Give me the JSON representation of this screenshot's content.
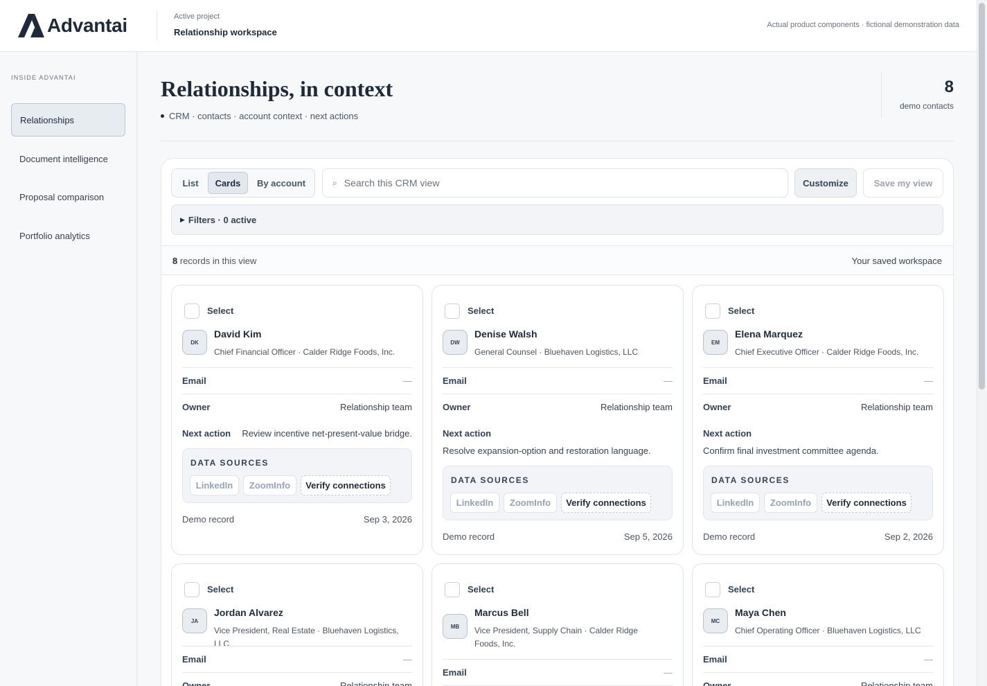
{
  "header": {
    "logo_text": "Advantai",
    "project_label": "Active project",
    "project_name": "Relationship workspace",
    "demo_note": "Actual product components · fictional demonstration data"
  },
  "sidebar": {
    "section_label": "INSIDE ADVANTAI",
    "items": [
      {
        "label": "Relationships",
        "active": true
      },
      {
        "label": "Document intelligence",
        "active": false
      },
      {
        "label": "Proposal comparison",
        "active": false
      },
      {
        "label": "Portfolio analytics",
        "active": false
      }
    ]
  },
  "main": {
    "title": "Relationships, in context",
    "subtitle": "CRM · contacts · account context · next actions",
    "stat_value": "8",
    "stat_label": "demo contacts"
  },
  "toolbar": {
    "views": [
      "List",
      "Cards",
      "By account"
    ],
    "active_view": "Cards",
    "search_placeholder": "Search this CRM view",
    "search_value": "",
    "customize_label": "Customize",
    "save_label": "Save my view",
    "filters_label": "Filters · 0 active",
    "records_count": "8",
    "records_suffix": "records in this view",
    "workspace_label": "Your saved workspace"
  },
  "card_labels": {
    "select": "Select",
    "email": "Email",
    "owner": "Owner",
    "next_action": "Next action",
    "data_sources": "DATA SOURCES",
    "linkedin": "LinkedIn",
    "zoominfo": "ZoomInfo",
    "verify": "Verify connections",
    "demo_record": "Demo record",
    "empty": "—"
  },
  "contacts": [
    {
      "initials": "DK",
      "name": "David Kim",
      "role": "Chief Financial Officer · Calder Ridge Foods, Inc.",
      "email": "—",
      "owner": "Relationship team",
      "next_action": "Review incentive net-present-value bridge.",
      "date": "Sep 3, 2026"
    },
    {
      "initials": "DW",
      "name": "Denise Walsh",
      "role": "General Counsel · Bluehaven Logistics, LLC",
      "email": "—",
      "owner": "Relationship team",
      "next_action": "Resolve expansion-option and restoration language.",
      "date": "Sep 5, 2026"
    },
    {
      "initials": "EM",
      "name": "Elena Marquez",
      "role": "Chief Executive Officer · Calder Ridge Foods, Inc.",
      "email": "—",
      "owner": "Relationship team",
      "next_action": "Confirm final investment committee agenda.",
      "date": "Sep 2, 2026"
    },
    {
      "initials": "JA",
      "name": "Jordan Alvarez",
      "role": "Vice President, Real Estate · Bluehaven Logistics, LLC",
      "email": "—",
      "owner": "Relationship team"
    },
    {
      "initials": "MB",
      "name": "Marcus Bell",
      "role": "Vice President, Supply Chain · Calder Ridge Foods, Inc.",
      "email": "—"
    },
    {
      "initials": "MC",
      "name": "Maya Chen",
      "role": "Chief Operating Officer · Bluehaven Logistics, LLC",
      "email": "—",
      "owner": "Relationship team"
    }
  ]
}
